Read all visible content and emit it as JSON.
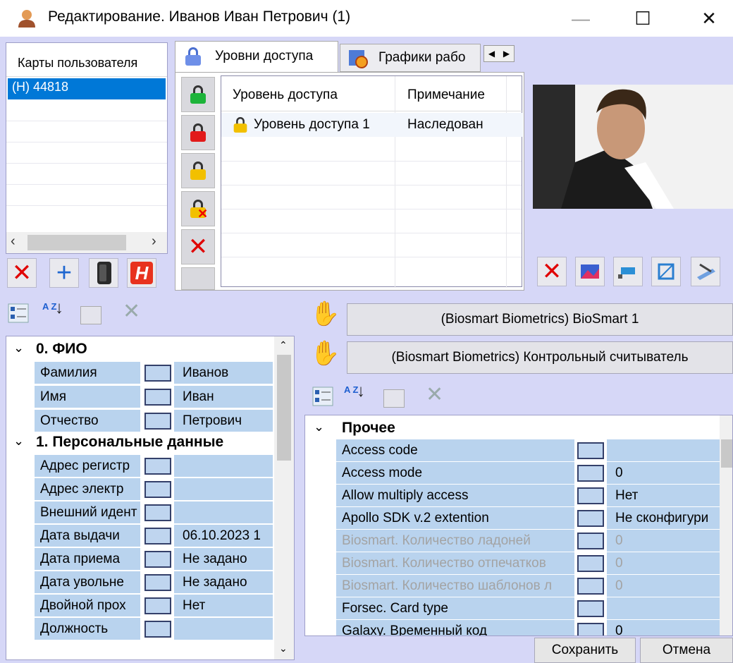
{
  "window": {
    "title": "Редактирование. Иванов Иван Петрович (1)",
    "minimize": "—",
    "maximize": "☐",
    "close": "✕"
  },
  "cards": {
    "header": "Карты пользователя",
    "items": [
      "(H) 44818"
    ]
  },
  "tabs": {
    "access_levels": "Уровни доступа",
    "schedules": "Графики рабо"
  },
  "access_grid": {
    "col_level": "Уровень доступа",
    "col_note": "Примечание",
    "rows": [
      {
        "level": "Уровень доступа 1",
        "note": "Наследован"
      }
    ]
  },
  "readers": {
    "reader1": "(Biosmart Biometrics) BioSmart 1",
    "reader2": "(Biosmart Biometrics) Контрольный считыватель"
  },
  "left_props": {
    "groups": [
      {
        "title": "0. ФИО",
        "items": [
          {
            "name": "Фамилия",
            "value": "Иванов"
          },
          {
            "name": "Имя",
            "value": "Иван"
          },
          {
            "name": "Отчество",
            "value": "Петрович"
          }
        ]
      },
      {
        "title": "1. Персональные данные",
        "items": [
          {
            "name": "Адрес регистр",
            "value": ""
          },
          {
            "name": "Адрес электр",
            "value": ""
          },
          {
            "name": "Внешний идент",
            "value": ""
          },
          {
            "name": "Дата выдачи",
            "value": "06.10.2023 1"
          },
          {
            "name": "Дата приема",
            "value": "Не задано"
          },
          {
            "name": "Дата увольне",
            "value": "Не задано"
          },
          {
            "name": "Двойной прох",
            "value": "Нет"
          },
          {
            "name": "Должность",
            "value": ""
          }
        ]
      }
    ]
  },
  "right_props": {
    "group": "Прочее",
    "items": [
      {
        "name": "Access code",
        "value": "",
        "disabled": false
      },
      {
        "name": "Access mode",
        "value": "0",
        "disabled": false
      },
      {
        "name": "Allow multiply access",
        "value": "Нет",
        "disabled": false
      },
      {
        "name": "Apollo SDK v.2 extention",
        "value": "Не сконфигури",
        "disabled": false
      },
      {
        "name": "Biosmart. Количество ладоней",
        "value": "0",
        "disabled": true
      },
      {
        "name": "Biosmart. Количество отпечатков",
        "value": "0",
        "disabled": true
      },
      {
        "name": "Biosmart. Количество шаблонов л",
        "value": "0",
        "disabled": true
      },
      {
        "name": "Forsec. Card type",
        "value": "",
        "disabled": false
      },
      {
        "name": "Galaxy. Временный код",
        "value": "0",
        "disabled": false
      }
    ]
  },
  "buttons": {
    "save": "Сохранить",
    "cancel": "Отмена"
  },
  "sort_az": "A Z"
}
